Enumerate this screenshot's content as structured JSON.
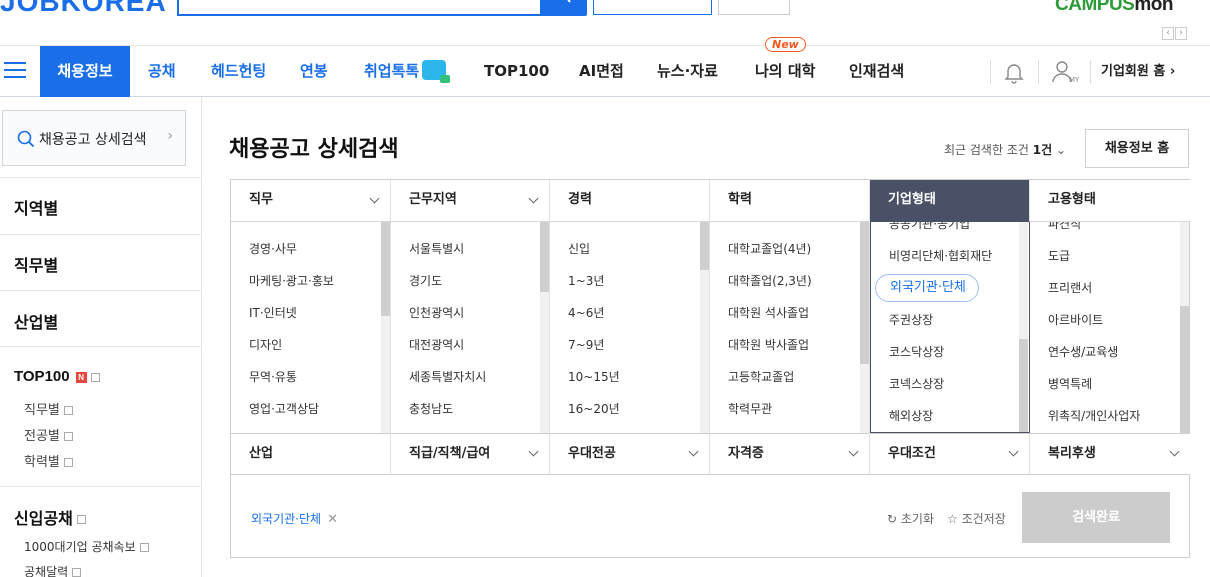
{
  "header": {
    "logo": "JOBKOREA",
    "campus_logo_a": "CAMPUS",
    "campus_logo_b": "mon",
    "campus_prev": "‹",
    "campus_next": "›"
  },
  "gnb": {
    "items": [
      "채용정보",
      "공채",
      "헤드헌팅",
      "연봉",
      "취업톡톡",
      "TOP100",
      "AI면접",
      "뉴스·자료",
      "나의 대학",
      "인재검색"
    ],
    "new_badge": "New",
    "my_label": "MY",
    "corp_home": "기업회원 홈 ›"
  },
  "sidebar": {
    "search_label": "채용공고 상세검색",
    "categories": [
      "지역별",
      "직무별",
      "산업별"
    ],
    "top100": {
      "title": "TOP100",
      "badge": "N",
      "subs": [
        "직무별",
        "전공별",
        "학력별"
      ]
    },
    "gongchae": {
      "title": "신입공채",
      "subs": [
        "1000대기업 공채속보",
        "공채달력"
      ]
    }
  },
  "main": {
    "title": "채용공고 상세검색",
    "recent_label": "최근 검색한 조건",
    "recent_count": "1건",
    "home_button": "채용정보 홈",
    "columns": [
      {
        "header": "직무",
        "items": [
          "경영·사무",
          "마케팅·광고·홍보",
          "IT·인터넷",
          "디자인",
          "무역·유통",
          "영업·고객상담"
        ]
      },
      {
        "header": "근무지역",
        "items": [
          "서울특별시",
          "경기도",
          "인천광역시",
          "대전광역시",
          "세종특별자치시",
          "충청남도"
        ]
      },
      {
        "header": "경력",
        "items": [
          "신입",
          "1~3년",
          "4~6년",
          "7~9년",
          "10~15년",
          "16~20년"
        ]
      },
      {
        "header": "학력",
        "items": [
          "대학교졸업(4년)",
          "대학졸업(2,3년)",
          "대학원 석사졸업",
          "대학원 박사졸업",
          "고등학교졸업",
          "학력무관"
        ]
      },
      {
        "header": "기업형태",
        "items": [
          "공공기관·공기업",
          "비영리단체·협회재단",
          "외국기관·단체",
          "주권상장",
          "코스닥상장",
          "코넥스상장",
          "해외상장"
        ]
      },
      {
        "header": "고용형태",
        "items": [
          "파견직",
          "도급",
          "프리랜서",
          "아르바이트",
          "연수생/교육생",
          "병역특례",
          "위촉직/개인사업자"
        ]
      }
    ],
    "row2": [
      "산업",
      "직급/직책/급여",
      "우대전공",
      "자격증",
      "우대조건",
      "복리후생"
    ],
    "selected_tag": "외국기관·단체",
    "reset_label": "초기화",
    "save_label": "조건저장",
    "done_button": "검색완료"
  },
  "colors": {
    "brand": "#1a6fe8",
    "selected_header": "#4a5066",
    "disabled_button": "#cccccc",
    "new_badge": "#f05a22"
  }
}
